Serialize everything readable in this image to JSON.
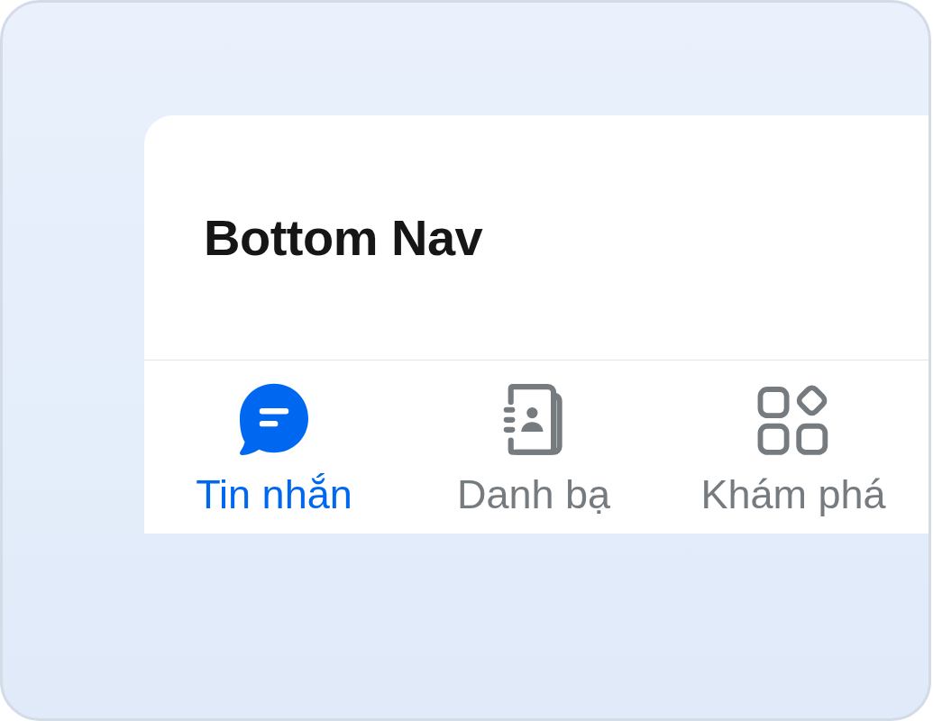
{
  "header": {
    "title": "Bottom Nav"
  },
  "bottom_nav": {
    "items": [
      {
        "label": "Tin nhắn",
        "selected": true
      },
      {
        "label": "Danh bạ",
        "selected": false
      },
      {
        "label": "Khám phá",
        "selected": false
      }
    ]
  }
}
